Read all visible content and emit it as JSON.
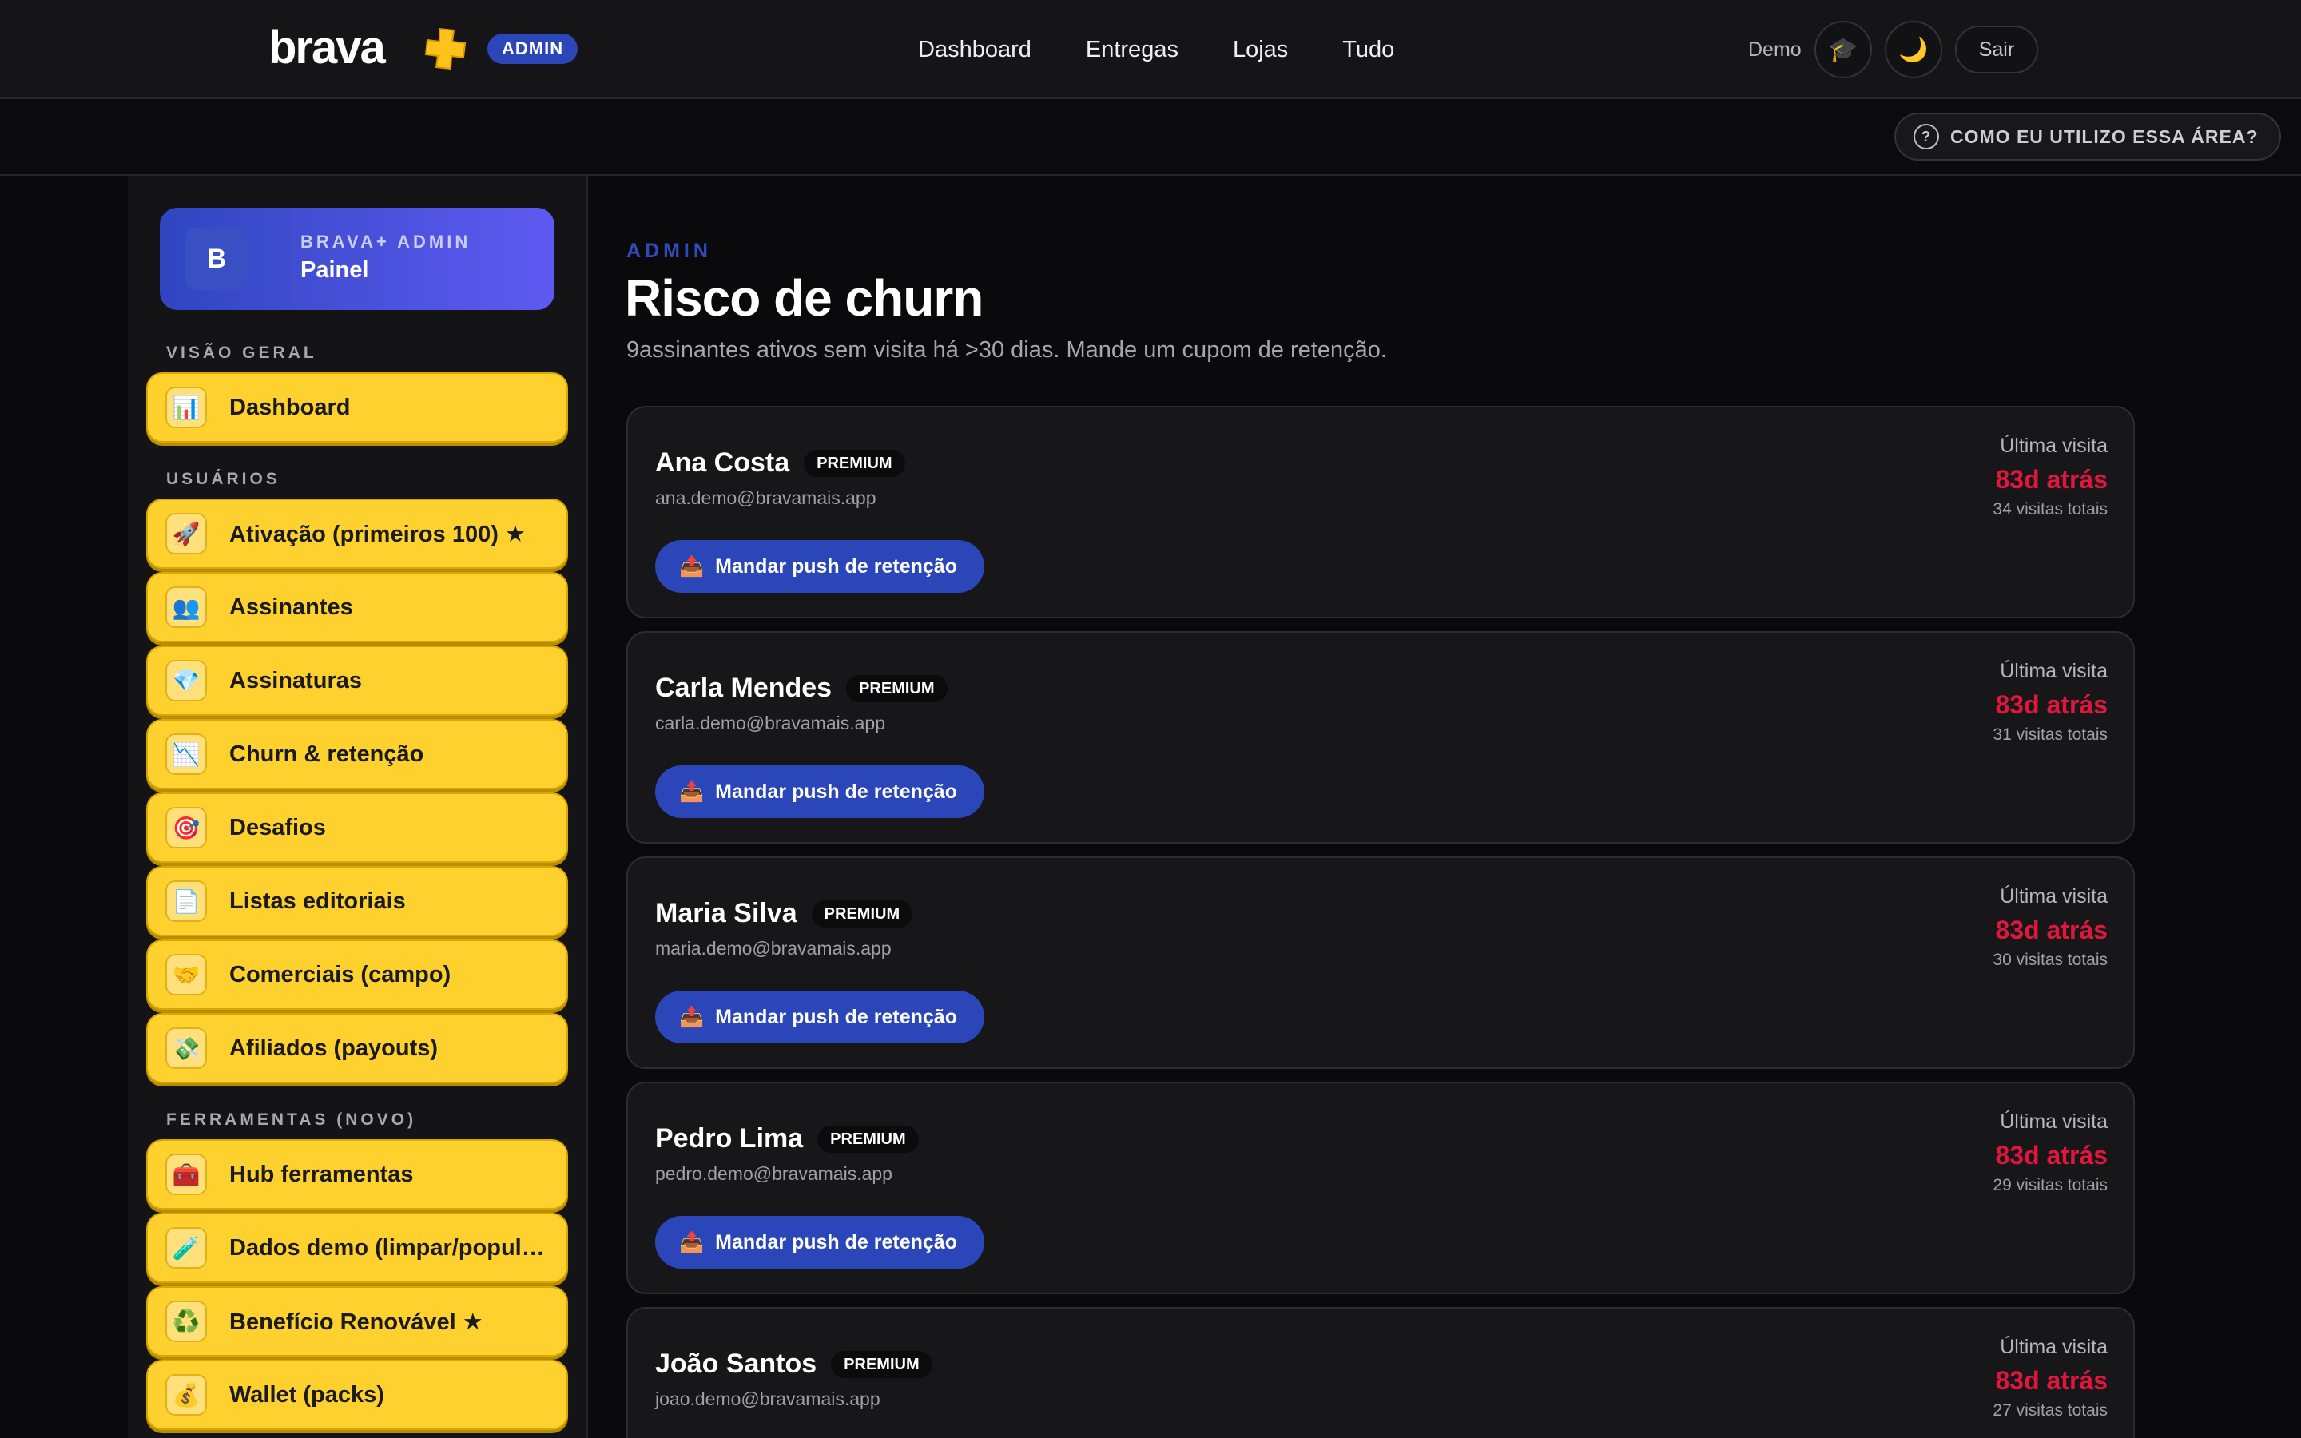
{
  "header": {
    "logo": "brava",
    "admin_badge": "ADMIN",
    "nav": [
      "Dashboard",
      "Entregas",
      "Lojas",
      "Tudo"
    ],
    "demo_label": "Demo",
    "icons": [
      "graduation-cap-icon",
      "moon-icon"
    ],
    "logout_label": "Sair"
  },
  "helpbar": {
    "help_label": "COMO EU UTILIZO ESSA ÁREA?",
    "help_icon": "?"
  },
  "sidebar": {
    "panel": {
      "avatar": "B",
      "kicker": "BRAVA+ ADMIN",
      "title": "Painel"
    },
    "sections": [
      {
        "label": "VISÃO GERAL"
      },
      {
        "label": "USUÁRIOS"
      },
      {
        "label": "FERRAMENTAS (NOVO)"
      }
    ],
    "items": [
      {
        "label": "Dashboard",
        "icon": "📊"
      },
      {
        "label": "Ativação (primeiros 100) ★",
        "icon": "🚀"
      },
      {
        "label": "Assinantes",
        "icon": "👥"
      },
      {
        "label": "Assinaturas",
        "icon": "💎"
      },
      {
        "label": "Churn & retenção",
        "icon": "📉"
      },
      {
        "label": "Desafios",
        "icon": "🎯"
      },
      {
        "label": "Listas editoriais",
        "icon": "📄"
      },
      {
        "label": "Comerciais (campo)",
        "icon": "🤝"
      },
      {
        "label": "Afiliados (payouts)",
        "icon": "💸"
      },
      {
        "label": "Hub ferramentas",
        "icon": "🧰"
      },
      {
        "label": "Dados demo (limpar/popular)",
        "icon": "🧪"
      },
      {
        "label": "Benefício Renovável ★",
        "icon": "♻️"
      },
      {
        "label": "Wallet (packs)",
        "icon": "💰"
      }
    ]
  },
  "main": {
    "kicker": "ADMIN",
    "title": "Risco de churn",
    "subtitle": "9assinantes ativos sem visita há >30 dias. Mande um cupom de retenção.",
    "last_visit_label": "Última visita",
    "push_label": "Mandar push de retenção",
    "push_icon": "📤",
    "cards": [
      {
        "name": "Ana Costa",
        "badge": "PREMIUM",
        "email": "ana.demo@bravamais.app",
        "last": "83d atrás",
        "total": "34 visitas totais"
      },
      {
        "name": "Carla Mendes",
        "badge": "PREMIUM",
        "email": "carla.demo@bravamais.app",
        "last": "83d atrás",
        "total": "31 visitas totais"
      },
      {
        "name": "Maria Silva",
        "badge": "PREMIUM",
        "email": "maria.demo@bravamais.app",
        "last": "83d atrás",
        "total": "30 visitas totais"
      },
      {
        "name": "Pedro Lima",
        "badge": "PREMIUM",
        "email": "pedro.demo@bravamais.app",
        "last": "83d atrás",
        "total": "29 visitas totais"
      },
      {
        "name": "João Santos",
        "badge": "PREMIUM",
        "email": "joao.demo@bravamais.app",
        "last": "83d atrás",
        "total": "27 visitas totais"
      }
    ]
  },
  "colors": {
    "accent": "#2b46b8",
    "sidebar_item": "#ffd12e",
    "danger": "#e0173c"
  }
}
